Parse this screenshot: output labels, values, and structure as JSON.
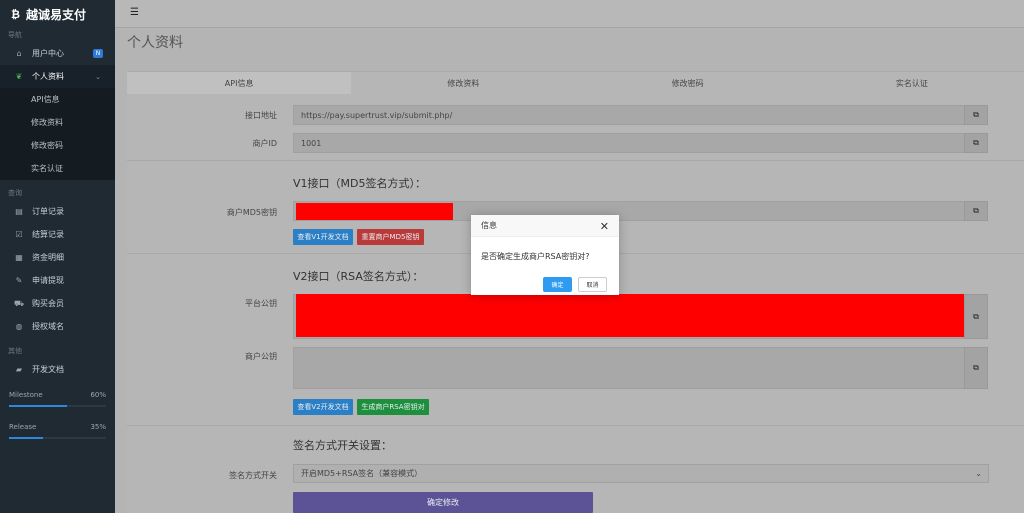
{
  "sidebar": {
    "brand": "越诚易支付",
    "brand_icon": "bitcoin-icon",
    "sections": {
      "nav": "导航",
      "query": "查询",
      "other": "其他"
    },
    "items": {
      "user_center": "用户中心",
      "user_center_badge": "N",
      "profile": "个人资料",
      "profile_sub": [
        "API信息",
        "修改资料",
        "修改密码",
        "实名认证"
      ],
      "orders": "订单记录",
      "settlement": "结算记录",
      "funds": "资金明细",
      "withdraw": "申请提现",
      "buy_member": "购买会员",
      "domain_auth": "授权域名",
      "dev_docs": "开发文档"
    },
    "progress": [
      {
        "label": "Milestone",
        "value": "60%",
        "fraction": 0.6
      },
      {
        "label": "Release",
        "value": "35%",
        "fraction": 0.35
      }
    ]
  },
  "page": {
    "title": "个人资料"
  },
  "tabs": [
    "API信息",
    "修改资料",
    "修改密码",
    "实名认证"
  ],
  "form": {
    "api_url_label": "接口地址",
    "api_url_value": "https://pay.supertrust.vip/submit.php/",
    "merchant_id_label": "商户ID",
    "merchant_id_value": "1001",
    "v1_heading": "V1接口（MD5签名方式）：",
    "md5_key_label": "商户MD5密钥",
    "btn_view_v1_docs": "查看V1开发文档",
    "btn_reset_md5": "重置商户MD5密钥",
    "v2_heading": "V2接口（RSA签名方式）：",
    "platform_pubkey_label": "平台公钥",
    "merchant_pubkey_label": "商户公钥",
    "btn_view_v2_docs": "查看V2开发文档",
    "btn_gen_rsa": "生成商户RSA密钥对",
    "sign_settings_heading": "签名方式开关设置：",
    "sign_mode_label": "签名方式开关",
    "sign_mode_value": "开启MD5+RSA签名（兼容模式）",
    "btn_submit": "确定修改"
  },
  "modal": {
    "title": "信息",
    "message": "是否确定生成商户RSA密钥对?",
    "confirm": "确定",
    "cancel": "取消"
  },
  "colors": {
    "accent_blue": "#2e86de",
    "danger_red": "#c9302c",
    "success_green": "#1e9d3a",
    "purple": "#6b5eae",
    "redaction": "#ff0000"
  }
}
